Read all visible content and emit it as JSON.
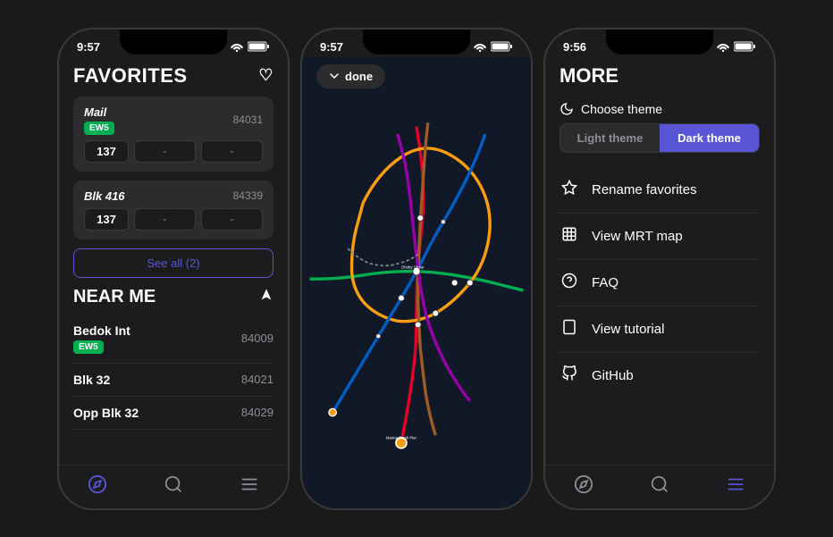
{
  "phones": [
    {
      "id": "favorites",
      "status": {
        "time": "9:57",
        "wifi": "📶",
        "battery": "🔋"
      },
      "title": "FAVORITES",
      "favorites": [
        {
          "name": "Mail",
          "code": "84031",
          "badge": "EW5",
          "bus": "137",
          "times": [
            "-",
            "-"
          ]
        },
        {
          "name": "Blk 416",
          "code": "84339",
          "badge": null,
          "bus": "137",
          "times": [
            "-",
            "-"
          ]
        }
      ],
      "see_all": "See all (2)",
      "near_me_title": "NEAR ME",
      "nearby": [
        {
          "name": "Bedok Int",
          "code": "84009",
          "badge": "EW5"
        },
        {
          "name": "Blk 32",
          "code": "84021",
          "badge": null
        },
        {
          "name": "Opp Blk 32",
          "code": "84029",
          "badge": null
        }
      ],
      "tabs": [
        "compass",
        "search",
        "sliders"
      ]
    },
    {
      "id": "map",
      "status": {
        "time": "9:57"
      },
      "done_label": "done"
    },
    {
      "id": "more",
      "status": {
        "time": "9:56"
      },
      "title": "MORE",
      "theme": {
        "label": "Choose theme",
        "light": "Light theme",
        "dark": "Dark theme"
      },
      "menu": [
        {
          "icon": "star",
          "label": "Rename favorites"
        },
        {
          "icon": "map",
          "label": "View MRT map"
        },
        {
          "icon": "question",
          "label": "FAQ"
        },
        {
          "icon": "tablet",
          "label": "View tutorial"
        },
        {
          "icon": "github",
          "label": "GitHub"
        }
      ],
      "tabs": [
        "compass",
        "search",
        "sliders"
      ]
    }
  ]
}
